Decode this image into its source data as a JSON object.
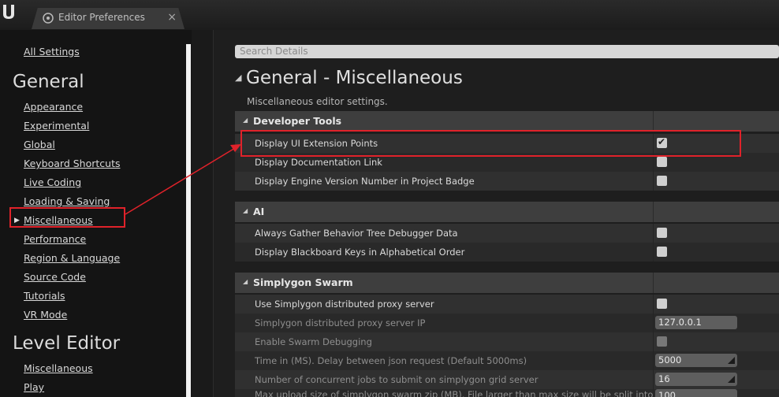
{
  "window": {
    "tab_title": "Editor Preferences",
    "tab_close": "×"
  },
  "sidebar": {
    "all_settings": "All Settings",
    "general_heading": "General",
    "general_items": [
      "Appearance",
      "Experimental",
      "Global",
      "Keyboard Shortcuts",
      "Live Coding",
      "Loading & Saving",
      "Miscellaneous",
      "Performance",
      "Region & Language",
      "Source Code",
      "Tutorials",
      "VR Mode"
    ],
    "selected_item": "Miscellaneous",
    "level_editor_heading": "Level Editor",
    "level_editor_items": [
      "Miscellaneous",
      "Play"
    ]
  },
  "details": {
    "search_placeholder": "Search Details",
    "section_title": "General - Miscellaneous",
    "section_description": "Miscellaneous editor settings.",
    "categories": {
      "developer_tools": {
        "label": "Developer Tools",
        "rows": [
          {
            "label": "Display UI Extension Points",
            "checked": true
          },
          {
            "label": "Display Documentation Link",
            "checked": false
          },
          {
            "label": "Display Engine Version Number in Project Badge",
            "checked": false
          }
        ]
      },
      "ai": {
        "label": "AI",
        "rows": [
          {
            "label": "Always Gather Behavior Tree Debugger Data",
            "checked": false
          },
          {
            "label": "Display Blackboard Keys in Alphabetical Order",
            "checked": false
          }
        ]
      },
      "simplygon": {
        "label": "Simplygon Swarm",
        "rows": [
          {
            "label": "Use Simplygon distributed proxy server",
            "checked": false
          },
          {
            "label": "Simplygon distributed proxy server IP",
            "value": "127.0.0.1"
          },
          {
            "label": "Enable Swarm Debugging",
            "checked": false
          },
          {
            "label": "Time in (MS). Delay between json request (Default 5000ms)",
            "value": "5000"
          },
          {
            "label": "Number of concurrent jobs to submit on simplygon grid server",
            "value": "16"
          },
          {
            "label": "Max upload size of simplygon swarm zip (MB). File larger than max size will be split into chunks",
            "value": "100"
          }
        ]
      }
    }
  },
  "colors": {
    "highlight": "#e0222a"
  }
}
